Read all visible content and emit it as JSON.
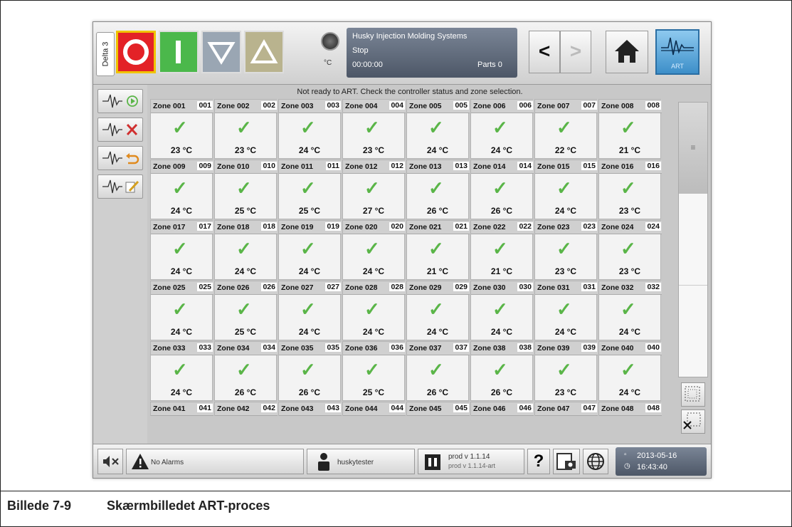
{
  "window": {
    "delta_tab": "Delta 3"
  },
  "status": {
    "title": "Husky Injection Molding Systems",
    "state": "Stop",
    "time": "00:00:00",
    "parts": "Parts 0",
    "unit": "°C"
  },
  "art_button": {
    "label": "ART"
  },
  "message": "Not ready to ART. Check the controller status and zone selection.",
  "zones": [
    {
      "name": "Zone 001",
      "num": "001",
      "temp": "23 °C"
    },
    {
      "name": "Zone 002",
      "num": "002",
      "temp": "23 °C"
    },
    {
      "name": "Zone 003",
      "num": "003",
      "temp": "24 °C"
    },
    {
      "name": "Zone 004",
      "num": "004",
      "temp": "23 °C"
    },
    {
      "name": "Zone 005",
      "num": "005",
      "temp": "24 °C"
    },
    {
      "name": "Zone 006",
      "num": "006",
      "temp": "24 °C"
    },
    {
      "name": "Zone 007",
      "num": "007",
      "temp": "22 °C"
    },
    {
      "name": "Zone 008",
      "num": "008",
      "temp": "21 °C"
    },
    {
      "name": "Zone 009",
      "num": "009",
      "temp": "24 °C"
    },
    {
      "name": "Zone 010",
      "num": "010",
      "temp": "25 °C"
    },
    {
      "name": "Zone 011",
      "num": "011",
      "temp": "25 °C"
    },
    {
      "name": "Zone 012",
      "num": "012",
      "temp": "27 °C"
    },
    {
      "name": "Zone 013",
      "num": "013",
      "temp": "26 °C"
    },
    {
      "name": "Zone 014",
      "num": "014",
      "temp": "26 °C"
    },
    {
      "name": "Zone 015",
      "num": "015",
      "temp": "24 °C"
    },
    {
      "name": "Zone 016",
      "num": "016",
      "temp": "23 °C"
    },
    {
      "name": "Zone 017",
      "num": "017",
      "temp": "24 °C"
    },
    {
      "name": "Zone 018",
      "num": "018",
      "temp": "24 °C"
    },
    {
      "name": "Zone 019",
      "num": "019",
      "temp": "24 °C"
    },
    {
      "name": "Zone 020",
      "num": "020",
      "temp": "24 °C"
    },
    {
      "name": "Zone 021",
      "num": "021",
      "temp": "21 °C"
    },
    {
      "name": "Zone 022",
      "num": "022",
      "temp": "21 °C"
    },
    {
      "name": "Zone 023",
      "num": "023",
      "temp": "23 °C"
    },
    {
      "name": "Zone 024",
      "num": "024",
      "temp": "23 °C"
    },
    {
      "name": "Zone 025",
      "num": "025",
      "temp": "24 °C"
    },
    {
      "name": "Zone 026",
      "num": "026",
      "temp": "25 °C"
    },
    {
      "name": "Zone 027",
      "num": "027",
      "temp": "24 °C"
    },
    {
      "name": "Zone 028",
      "num": "028",
      "temp": "24 °C"
    },
    {
      "name": "Zone 029",
      "num": "029",
      "temp": "24 °C"
    },
    {
      "name": "Zone 030",
      "num": "030",
      "temp": "24 °C"
    },
    {
      "name": "Zone 031",
      "num": "031",
      "temp": "24 °C"
    },
    {
      "name": "Zone 032",
      "num": "032",
      "temp": "24 °C"
    },
    {
      "name": "Zone 033",
      "num": "033",
      "temp": "24 °C"
    },
    {
      "name": "Zone 034",
      "num": "034",
      "temp": "26 °C"
    },
    {
      "name": "Zone 035",
      "num": "035",
      "temp": "26 °C"
    },
    {
      "name": "Zone 036",
      "num": "036",
      "temp": "25 °C"
    },
    {
      "name": "Zone 037",
      "num": "037",
      "temp": "26 °C"
    },
    {
      "name": "Zone 038",
      "num": "038",
      "temp": "26 °C"
    },
    {
      "name": "Zone 039",
      "num": "039",
      "temp": "23 °C"
    },
    {
      "name": "Zone 040",
      "num": "040",
      "temp": "24 °C"
    },
    {
      "name": "Zone 041",
      "num": "041",
      "temp": ""
    },
    {
      "name": "Zone 042",
      "num": "042",
      "temp": ""
    },
    {
      "name": "Zone 043",
      "num": "043",
      "temp": ""
    },
    {
      "name": "Zone 044",
      "num": "044",
      "temp": ""
    },
    {
      "name": "Zone 045",
      "num": "045",
      "temp": ""
    },
    {
      "name": "Zone 046",
      "num": "046",
      "temp": ""
    },
    {
      "name": "Zone 047",
      "num": "047",
      "temp": ""
    },
    {
      "name": "Zone 048",
      "num": "048",
      "temp": ""
    }
  ],
  "bottom": {
    "alarms": "No Alarms",
    "user": "huskytester",
    "version1": "prod v 1.1.14",
    "version2": "prod v 1.1.14-art",
    "help": "?",
    "date": "2013-05-16",
    "time": "16:43:40"
  },
  "caption": {
    "figure": "Billede 7-9",
    "title": "Skærmbilledet ART-proces"
  },
  "colors": {
    "stop": "#e32227",
    "run": "#4bb84b",
    "check": "#5ab548",
    "art": "#3d8fc9"
  }
}
